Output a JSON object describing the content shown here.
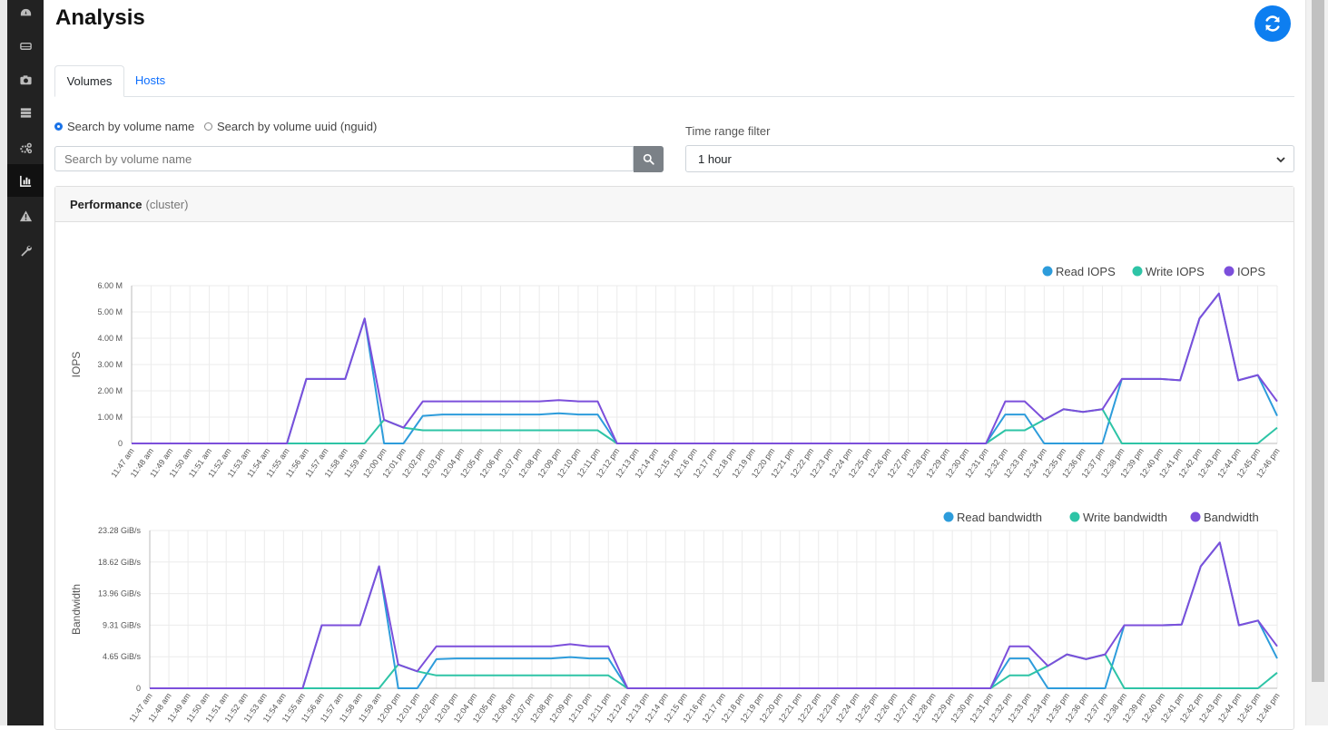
{
  "page": {
    "title": "Analysis"
  },
  "sidebar": {
    "items": [
      "dashboard-icon",
      "drive-icon",
      "camera-icon",
      "server-icon",
      "gears-icon",
      "chart-icon",
      "warning-icon",
      "wrench-icon"
    ],
    "active": 5
  },
  "tabs": [
    {
      "label": "Volumes"
    },
    {
      "label": "Hosts"
    }
  ],
  "search": {
    "radio_name": "Search by volume name",
    "radio_uuid": "Search by volume uuid (nguid)",
    "placeholder": "Search by volume name",
    "time_label": "Time range filter",
    "time_value": "1 hour"
  },
  "card": {
    "title": "Performance",
    "subtitle": "(cluster)"
  },
  "colors": {
    "read": "#2d9cdb",
    "write": "#2ec4a6",
    "total": "#7c4fdb",
    "accent": "#0d7ef0"
  },
  "chart_data": [
    {
      "type": "line",
      "ylabel": "IOPS",
      "ylim": [
        0,
        6000000
      ],
      "yticks": [
        "0",
        "1.00 M",
        "2.00 M",
        "3.00 M",
        "4.00 M",
        "5.00 M",
        "6.00 M"
      ],
      "grid": true,
      "legend": "top-right",
      "x": [
        "11:47 am",
        "11:48 am",
        "11:49 am",
        "11:50 am",
        "11:51 am",
        "11:52 am",
        "11:53 am",
        "11:54 am",
        "11:55 am",
        "11:56 am",
        "11:57 am",
        "11:58 am",
        "11:59 am",
        "12:00 pm",
        "12:01 pm",
        "12:02 pm",
        "12:03 pm",
        "12:04 pm",
        "12:05 pm",
        "12:06 pm",
        "12:07 pm",
        "12:08 pm",
        "12:09 pm",
        "12:10 pm",
        "12:11 pm",
        "12:12 pm",
        "12:13 pm",
        "12:14 pm",
        "12:15 pm",
        "12:16 pm",
        "12:17 pm",
        "12:18 pm",
        "12:19 pm",
        "12:20 pm",
        "12:21 pm",
        "12:22 pm",
        "12:23 pm",
        "12:24 pm",
        "12:25 pm",
        "12:26 pm",
        "12:27 pm",
        "12:28 pm",
        "12:29 pm",
        "12:30 pm",
        "12:31 pm",
        "12:32 pm",
        "12:33 pm",
        "12:34 pm",
        "12:35 pm",
        "12:36 pm",
        "12:37 pm",
        "12:38 pm",
        "12:39 pm",
        "12:40 pm",
        "12:41 pm",
        "12:42 pm",
        "12:43 pm",
        "12:44 pm",
        "12:45 pm",
        "12:46 pm"
      ],
      "series": [
        {
          "name": "Read IOPS",
          "values": [
            0,
            0,
            0,
            0,
            0,
            0,
            0,
            0,
            0,
            2450000,
            2450000,
            2450000,
            4750000,
            0,
            0,
            1050000,
            1100000,
            1100000,
            1100000,
            1100000,
            1100000,
            1100000,
            1150000,
            1100000,
            1100000,
            0,
            0,
            0,
            0,
            0,
            0,
            0,
            0,
            0,
            0,
            0,
            0,
            0,
            0,
            0,
            0,
            0,
            0,
            0,
            0,
            1100000,
            1100000,
            0,
            0,
            0,
            0,
            2450000,
            2450000,
            2450000,
            2400000,
            4750000,
            5700000,
            2400000,
            2600000,
            1050000
          ]
        },
        {
          "name": "Write IOPS",
          "values": [
            0,
            0,
            0,
            0,
            0,
            0,
            0,
            0,
            0,
            0,
            0,
            0,
            0,
            900000,
            600000,
            500000,
            500000,
            500000,
            500000,
            500000,
            500000,
            500000,
            500000,
            500000,
            500000,
            0,
            0,
            0,
            0,
            0,
            0,
            0,
            0,
            0,
            0,
            0,
            0,
            0,
            0,
            0,
            0,
            0,
            0,
            0,
            0,
            500000,
            500000,
            900000,
            1300000,
            1200000,
            1300000,
            0,
            0,
            0,
            0,
            0,
            0,
            0,
            0,
            600000
          ]
        },
        {
          "name": "IOPS",
          "values": [
            0,
            0,
            0,
            0,
            0,
            0,
            0,
            0,
            0,
            2450000,
            2450000,
            2450000,
            4750000,
            900000,
            600000,
            1600000,
            1600000,
            1600000,
            1600000,
            1600000,
            1600000,
            1600000,
            1650000,
            1600000,
            1600000,
            0,
            0,
            0,
            0,
            0,
            0,
            0,
            0,
            0,
            0,
            0,
            0,
            0,
            0,
            0,
            0,
            0,
            0,
            0,
            0,
            1600000,
            1600000,
            900000,
            1300000,
            1200000,
            1300000,
            2450000,
            2450000,
            2450000,
            2400000,
            4750000,
            5700000,
            2400000,
            2600000,
            1600000
          ]
        }
      ]
    },
    {
      "type": "line",
      "ylabel": "Bandwidth",
      "ylim": [
        0,
        23.28
      ],
      "yunit": "GiB/s",
      "yticks": [
        "0",
        "4.65 GiB/s",
        "9.31 GiB/s",
        "13.96 GiB/s",
        "18.62 GiB/s",
        "23.28 GiB/s"
      ],
      "grid": true,
      "legend": "top-right",
      "x": [
        "11:47 am",
        "11:48 am",
        "11:49 am",
        "11:50 am",
        "11:51 am",
        "11:52 am",
        "11:53 am",
        "11:54 am",
        "11:55 am",
        "11:56 am",
        "11:57 am",
        "11:58 am",
        "11:59 am",
        "12:00 pm",
        "12:01 pm",
        "12:02 pm",
        "12:03 pm",
        "12:04 pm",
        "12:05 pm",
        "12:06 pm",
        "12:07 pm",
        "12:08 pm",
        "12:09 pm",
        "12:10 pm",
        "12:11 pm",
        "12:12 pm",
        "12:13 pm",
        "12:14 pm",
        "12:15 pm",
        "12:16 pm",
        "12:17 pm",
        "12:18 pm",
        "12:19 pm",
        "12:20 pm",
        "12:21 pm",
        "12:22 pm",
        "12:23 pm",
        "12:24 pm",
        "12:25 pm",
        "12:26 pm",
        "12:27 pm",
        "12:28 pm",
        "12:29 pm",
        "12:30 pm",
        "12:31 pm",
        "12:32 pm",
        "12:33 pm",
        "12:34 pm",
        "12:35 pm",
        "12:36 pm",
        "12:37 pm",
        "12:38 pm",
        "12:39 pm",
        "12:40 pm",
        "12:41 pm",
        "12:42 pm",
        "12:43 pm",
        "12:44 pm",
        "12:45 pm",
        "12:46 pm"
      ],
      "series": [
        {
          "name": "Read bandwidth",
          "values": [
            0,
            0,
            0,
            0,
            0,
            0,
            0,
            0,
            0,
            9.3,
            9.3,
            9.3,
            18.0,
            0,
            0,
            4.3,
            4.4,
            4.4,
            4.4,
            4.4,
            4.4,
            4.4,
            4.6,
            4.4,
            4.4,
            0,
            0,
            0,
            0,
            0,
            0,
            0,
            0,
            0,
            0,
            0,
            0,
            0,
            0,
            0,
            0,
            0,
            0,
            0,
            0,
            4.4,
            4.4,
            0,
            0,
            0,
            0,
            9.3,
            9.3,
            9.3,
            9.4,
            18.0,
            21.5,
            9.3,
            10.0,
            4.4
          ]
        },
        {
          "name": "Write bandwidth",
          "values": [
            0,
            0,
            0,
            0,
            0,
            0,
            0,
            0,
            0,
            0,
            0,
            0,
            0,
            3.5,
            2.5,
            1.9,
            1.9,
            1.9,
            1.9,
            1.9,
            1.9,
            1.9,
            1.9,
            1.9,
            1.9,
            0,
            0,
            0,
            0,
            0,
            0,
            0,
            0,
            0,
            0,
            0,
            0,
            0,
            0,
            0,
            0,
            0,
            0,
            0,
            0,
            1.9,
            1.9,
            3.3,
            5.0,
            4.3,
            5.0,
            0,
            0,
            0,
            0,
            0,
            0,
            0,
            0,
            2.3
          ]
        },
        {
          "name": "Bandwidth",
          "values": [
            0,
            0,
            0,
            0,
            0,
            0,
            0,
            0,
            0,
            9.3,
            9.3,
            9.3,
            18.0,
            3.5,
            2.5,
            6.2,
            6.2,
            6.2,
            6.2,
            6.2,
            6.2,
            6.2,
            6.5,
            6.2,
            6.2,
            0,
            0,
            0,
            0,
            0,
            0,
            0,
            0,
            0,
            0,
            0,
            0,
            0,
            0,
            0,
            0,
            0,
            0,
            0,
            0,
            6.2,
            6.2,
            3.3,
            5.0,
            4.3,
            5.0,
            9.3,
            9.3,
            9.3,
            9.4,
            18.0,
            21.5,
            9.3,
            10.0,
            6.2
          ]
        }
      ]
    }
  ]
}
